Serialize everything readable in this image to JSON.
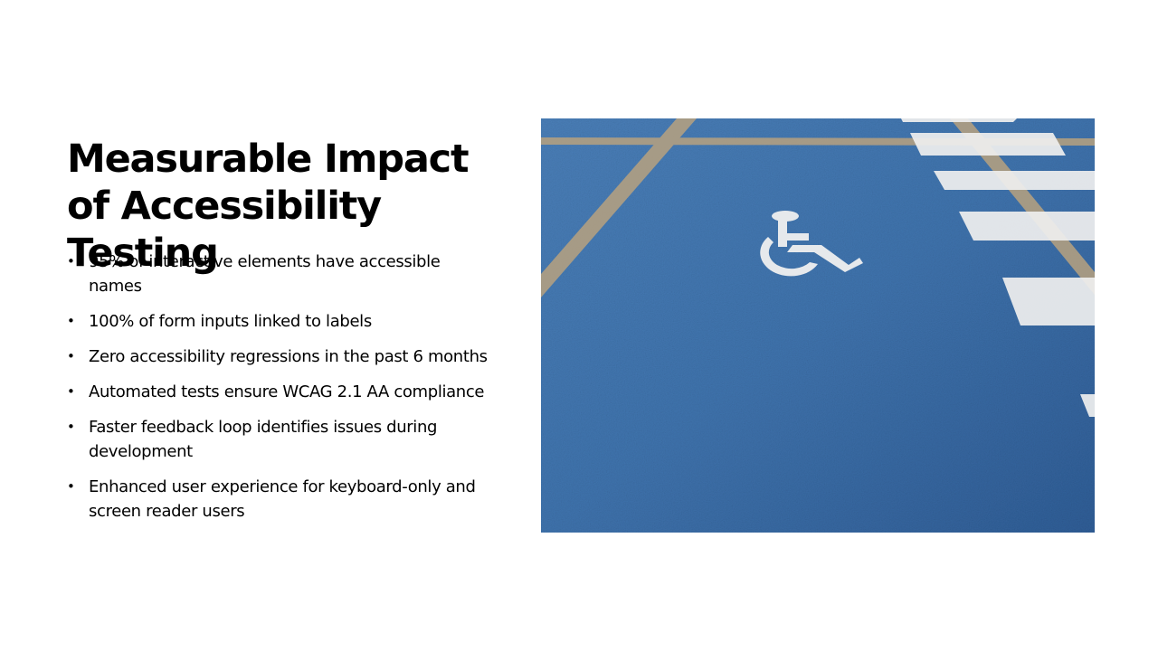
{
  "slide": {
    "title": "Measurable Impact of Accessibility Testing",
    "bullet_symbol": "•",
    "bullets": [
      "95% of interactive elements have accessible names",
      "100% of form inputs linked to labels",
      "Zero accessibility regressions in the past 6 months",
      "Automated tests ensure WCAG 2.1 AA compliance",
      "Faster feedback loop identifies issues during development",
      "Enhanced user experience for keyboard-only and screen reader users"
    ],
    "photo": {
      "subject": "wheelchair-accessible parking space",
      "colors": {
        "pavement": "#3f73ad",
        "pavement_dark": "#2f5d96",
        "lines": "#b9a27f",
        "paint": "#f2f2f2"
      }
    }
  }
}
